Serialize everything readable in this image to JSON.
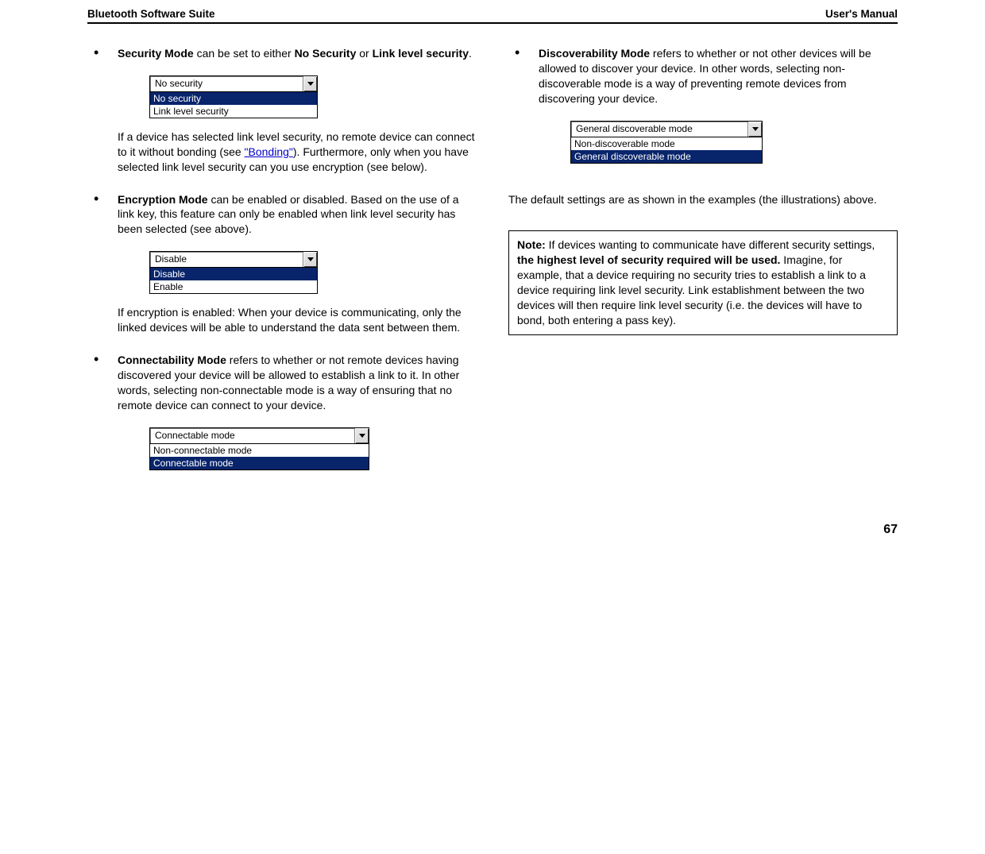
{
  "header": {
    "left": "Bluetooth Software Suite",
    "right": "User's Manual"
  },
  "page_number": "67",
  "left": {
    "security": {
      "title_bold1": "Security Mode",
      "mid": " can be set to either ",
      "bold2": "No Security",
      "or": " or ",
      "bold3": "Link level security",
      "tail": ".",
      "combo": {
        "value": "No security",
        "options": [
          "No security",
          "Link level security"
        ],
        "selected_index": 0
      },
      "para2_pre": "If a device has selected link level security, no remote device can connect to it without bonding (see ",
      "link": "\"Bonding\"",
      "para2_post": "). Furthermore, only when you have selected link level security can you use encryption (see below)."
    },
    "encryption": {
      "bold": "Encryption Mode",
      "rest": " can be enabled or disabled. Based on the use of a link key, this feature can only be enabled when link level security has been selected (see above).",
      "combo": {
        "value": "Disable",
        "options": [
          "Disable",
          "Enable"
        ],
        "selected_index": 0
      },
      "para2": "If encryption is enabled: When your device is communicating, only the linked devices will be able to understand the data sent between them."
    },
    "connectability": {
      "bold": "Connectability Mode",
      "rest": " refers to whether or not remote devices having discovered your device will be allowed to establish a link to it. In other words, selecting non-connectable mode is a way of ensuring that no remote device can connect to your device.",
      "combo": {
        "value": "Connectable mode",
        "options": [
          "Non-connectable mode",
          "Connectable mode"
        ],
        "selected_index": 1
      }
    }
  },
  "right": {
    "discoverability": {
      "bold": "Discoverability Mode",
      "rest": " refers to whether or not other devices will be allowed to discover your device. In other words, selecting non-discoverable mode is a way of preventing remote devices from discovering your device.",
      "combo": {
        "value": "General discoverable mode",
        "options": [
          "Non-discoverable mode",
          "General discoverable mode"
        ],
        "selected_index": 1
      }
    },
    "default_text": "The default settings are as shown in the examples (the illustrations) above.",
    "note": {
      "label": "Note:",
      "pre": " If devices wanting to communicate have different security settings, ",
      "bold": "the highest level of security required will be used.",
      "post": " Imagine, for example, that a device requiring no security tries to establish a link to a device requiring link level security. Link establishment between the two devices will then require link level security (i.e. the devices will have to bond, both entering a pass key)."
    }
  }
}
